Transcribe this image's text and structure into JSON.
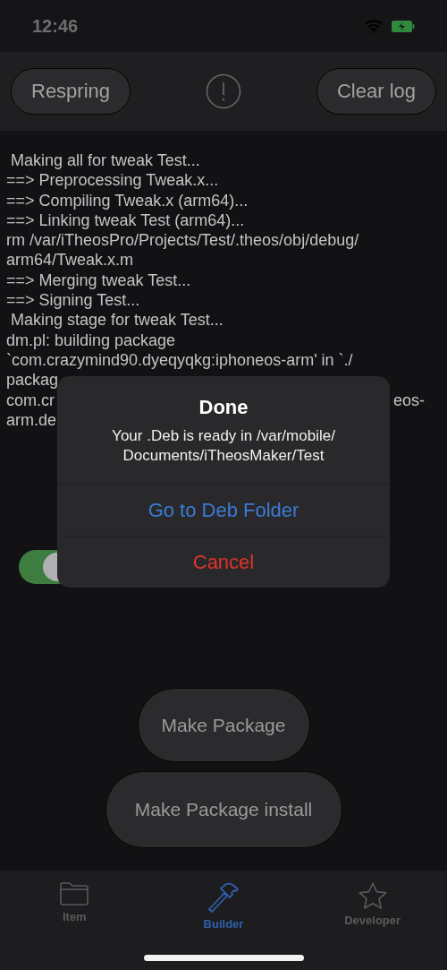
{
  "status_bar": {
    "time": "12:46"
  },
  "toolbar": {
    "left_button": "Respring",
    "right_button": "Clear log"
  },
  "log": [
    {
      "text": " Making all for tweak Test..."
    },
    {
      "text": "==> Preprocessing Tweak.x..."
    },
    {
      "text": "==> Compiling Tweak.x (arm64)..."
    },
    {
      "text": "==> Linking tweak Test (arm64)..."
    },
    {
      "text": "rm /var/iTheosPro/Projects/Test/.theos/obj/debug/"
    },
    {
      "text": "arm64/Tweak.x.m"
    },
    {
      "text": "==> Merging tweak Test..."
    },
    {
      "text": "==> Signing Test..."
    },
    {
      "text": " Making stage for tweak Test..."
    },
    {
      "text": "dm.pl: building package"
    },
    {
      "text": "`com.crazymind90.dyeqyqkg:iphoneos-arm' in `./"
    },
    {
      "text": "packag"
    },
    {
      "text": "com.cr",
      "right": "eos-"
    },
    {
      "text": "arm.de"
    }
  ],
  "toggle": {
    "on": true
  },
  "buttons": [
    "Make Package",
    "Make Package install"
  ],
  "alert": {
    "title": "Done",
    "message": "Your .Deb is ready in /var/mobile/ Documents/iTheosMaker/Test",
    "actions": [
      {
        "label": "Go to Deb Folder",
        "kind": "default"
      },
      {
        "label": "Cancel",
        "kind": "destructive"
      }
    ]
  },
  "tabs": [
    {
      "label": "Item",
      "selected": false
    },
    {
      "label": "Builder",
      "selected": true
    },
    {
      "label": "Developer",
      "selected": false
    }
  ]
}
